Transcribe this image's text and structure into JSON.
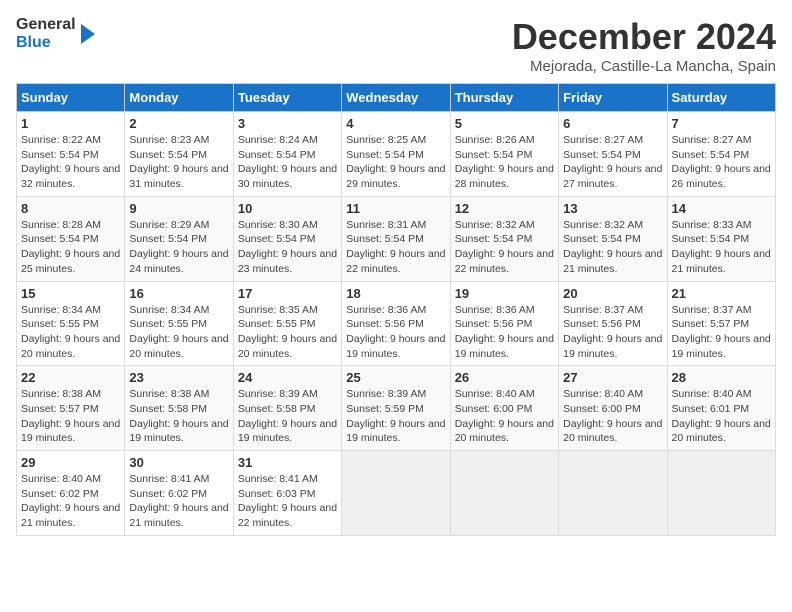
{
  "logo": {
    "line1": "General",
    "line2": "Blue"
  },
  "title": "December 2024",
  "subtitle": "Mejorada, Castille-La Mancha, Spain",
  "days_header": [
    "Sunday",
    "Monday",
    "Tuesday",
    "Wednesday",
    "Thursday",
    "Friday",
    "Saturday"
  ],
  "weeks": [
    [
      {
        "day": "1",
        "info": "Sunrise: 8:22 AM\nSunset: 5:54 PM\nDaylight: 9 hours and 32 minutes."
      },
      {
        "day": "2",
        "info": "Sunrise: 8:23 AM\nSunset: 5:54 PM\nDaylight: 9 hours and 31 minutes."
      },
      {
        "day": "3",
        "info": "Sunrise: 8:24 AM\nSunset: 5:54 PM\nDaylight: 9 hours and 30 minutes."
      },
      {
        "day": "4",
        "info": "Sunrise: 8:25 AM\nSunset: 5:54 PM\nDaylight: 9 hours and 29 minutes."
      },
      {
        "day": "5",
        "info": "Sunrise: 8:26 AM\nSunset: 5:54 PM\nDaylight: 9 hours and 28 minutes."
      },
      {
        "day": "6",
        "info": "Sunrise: 8:27 AM\nSunset: 5:54 PM\nDaylight: 9 hours and 27 minutes."
      },
      {
        "day": "7",
        "info": "Sunrise: 8:27 AM\nSunset: 5:54 PM\nDaylight: 9 hours and 26 minutes."
      }
    ],
    [
      {
        "day": "8",
        "info": "Sunrise: 8:28 AM\nSunset: 5:54 PM\nDaylight: 9 hours and 25 minutes."
      },
      {
        "day": "9",
        "info": "Sunrise: 8:29 AM\nSunset: 5:54 PM\nDaylight: 9 hours and 24 minutes."
      },
      {
        "day": "10",
        "info": "Sunrise: 8:30 AM\nSunset: 5:54 PM\nDaylight: 9 hours and 23 minutes."
      },
      {
        "day": "11",
        "info": "Sunrise: 8:31 AM\nSunset: 5:54 PM\nDaylight: 9 hours and 22 minutes."
      },
      {
        "day": "12",
        "info": "Sunrise: 8:32 AM\nSunset: 5:54 PM\nDaylight: 9 hours and 22 minutes."
      },
      {
        "day": "13",
        "info": "Sunrise: 8:32 AM\nSunset: 5:54 PM\nDaylight: 9 hours and 21 minutes."
      },
      {
        "day": "14",
        "info": "Sunrise: 8:33 AM\nSunset: 5:54 PM\nDaylight: 9 hours and 21 minutes."
      }
    ],
    [
      {
        "day": "15",
        "info": "Sunrise: 8:34 AM\nSunset: 5:55 PM\nDaylight: 9 hours and 20 minutes."
      },
      {
        "day": "16",
        "info": "Sunrise: 8:34 AM\nSunset: 5:55 PM\nDaylight: 9 hours and 20 minutes."
      },
      {
        "day": "17",
        "info": "Sunrise: 8:35 AM\nSunset: 5:55 PM\nDaylight: 9 hours and 20 minutes."
      },
      {
        "day": "18",
        "info": "Sunrise: 8:36 AM\nSunset: 5:56 PM\nDaylight: 9 hours and 19 minutes."
      },
      {
        "day": "19",
        "info": "Sunrise: 8:36 AM\nSunset: 5:56 PM\nDaylight: 9 hours and 19 minutes."
      },
      {
        "day": "20",
        "info": "Sunrise: 8:37 AM\nSunset: 5:56 PM\nDaylight: 9 hours and 19 minutes."
      },
      {
        "day": "21",
        "info": "Sunrise: 8:37 AM\nSunset: 5:57 PM\nDaylight: 9 hours and 19 minutes."
      }
    ],
    [
      {
        "day": "22",
        "info": "Sunrise: 8:38 AM\nSunset: 5:57 PM\nDaylight: 9 hours and 19 minutes."
      },
      {
        "day": "23",
        "info": "Sunrise: 8:38 AM\nSunset: 5:58 PM\nDaylight: 9 hours and 19 minutes."
      },
      {
        "day": "24",
        "info": "Sunrise: 8:39 AM\nSunset: 5:58 PM\nDaylight: 9 hours and 19 minutes."
      },
      {
        "day": "25",
        "info": "Sunrise: 8:39 AM\nSunset: 5:59 PM\nDaylight: 9 hours and 19 minutes."
      },
      {
        "day": "26",
        "info": "Sunrise: 8:40 AM\nSunset: 6:00 PM\nDaylight: 9 hours and 20 minutes."
      },
      {
        "day": "27",
        "info": "Sunrise: 8:40 AM\nSunset: 6:00 PM\nDaylight: 9 hours and 20 minutes."
      },
      {
        "day": "28",
        "info": "Sunrise: 8:40 AM\nSunset: 6:01 PM\nDaylight: 9 hours and 20 minutes."
      }
    ],
    [
      {
        "day": "29",
        "info": "Sunrise: 8:40 AM\nSunset: 6:02 PM\nDaylight: 9 hours and 21 minutes."
      },
      {
        "day": "30",
        "info": "Sunrise: 8:41 AM\nSunset: 6:02 PM\nDaylight: 9 hours and 21 minutes."
      },
      {
        "day": "31",
        "info": "Sunrise: 8:41 AM\nSunset: 6:03 PM\nDaylight: 9 hours and 22 minutes."
      },
      {
        "day": "",
        "info": ""
      },
      {
        "day": "",
        "info": ""
      },
      {
        "day": "",
        "info": ""
      },
      {
        "day": "",
        "info": ""
      }
    ]
  ]
}
